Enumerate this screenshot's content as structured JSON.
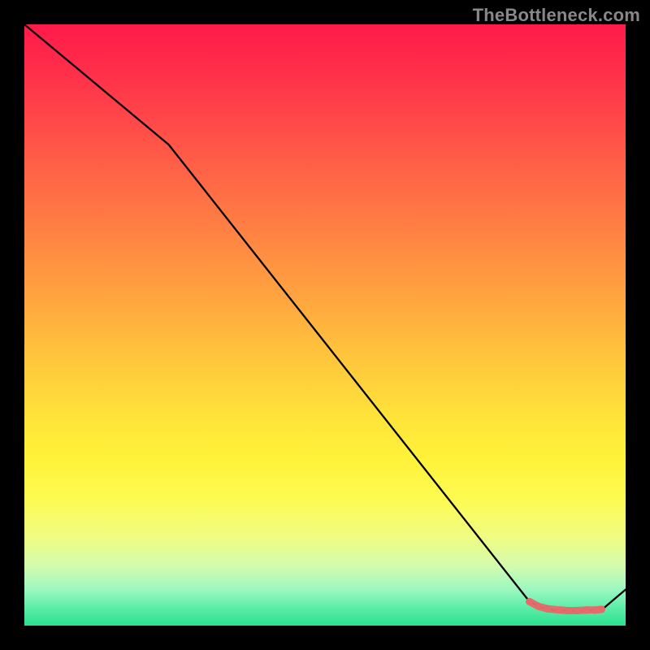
{
  "watermark": "TheBottleneck.com",
  "chart_data": {
    "type": "line",
    "title": "",
    "xlabel": "",
    "ylabel": "",
    "xlim": [
      0,
      100
    ],
    "ylim": [
      0,
      100
    ],
    "grid": false,
    "legend": false,
    "series": [
      {
        "name": "curve",
        "color": "#000000",
        "x": [
          0,
          24,
          84,
          86,
          88,
          90,
          92,
          94,
          96,
          100
        ],
        "y": [
          100,
          80,
          4,
          3,
          2.6,
          2.5,
          2.4,
          2.5,
          2.6,
          6
        ]
      }
    ],
    "markers": {
      "name": "hover-band",
      "color": "#e56a6a",
      "points": [
        {
          "x": 84,
          "y": 4.0
        },
        {
          "x": 85.5,
          "y": 3.2
        },
        {
          "x": 87,
          "y": 2.8
        },
        {
          "x": 89,
          "y": 2.6
        },
        {
          "x": 90.5,
          "y": 2.5
        },
        {
          "x": 92,
          "y": 2.5
        },
        {
          "x": 93.5,
          "y": 2.6
        },
        {
          "x": 95,
          "y": 2.6
        },
        {
          "x": 96,
          "y": 2.7
        }
      ]
    },
    "background_gradient": [
      {
        "pos": 0,
        "color": "#ff1a4a"
      },
      {
        "pos": 50,
        "color": "#ffc43c"
      },
      {
        "pos": 75,
        "color": "#fff239"
      },
      {
        "pos": 100,
        "color": "#29e08e"
      }
    ]
  }
}
